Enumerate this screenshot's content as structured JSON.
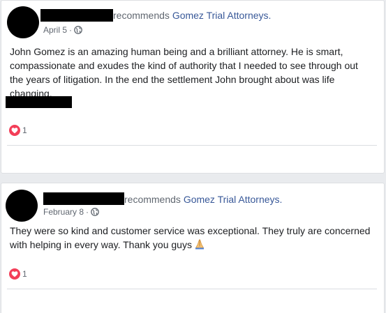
{
  "posts": [
    {
      "recommends_text": "recommends ",
      "page_name": "Gomez Trial Attorneys.",
      "date": "April 5",
      "separator": "·",
      "privacy_icon": "globe-icon",
      "body": "John Gomez is an amazing human being and a brilliant attorney. He is smart, compassionate and exudes the kind of authority that I needed to see through out the years of litigation. In the end the settlement John brought about was life changing.",
      "reaction_icon": "heart-icon",
      "reaction_count": "1"
    },
    {
      "recommends_text": "recommends ",
      "page_name": "Gomez Trial Attorneys.",
      "date": "February 8",
      "separator": "·",
      "privacy_icon": "globe-icon",
      "body": "They were so kind and customer service was exceptional. They truly are concerned with helping in every way. Thank you guys",
      "emoji": "folded-hands-icon",
      "reaction_icon": "heart-icon",
      "reaction_count": "1"
    }
  ],
  "colors": {
    "link": "#385898",
    "secondary_text": "#606770",
    "primary_text": "#1c1e21",
    "love_red": "#f33e58",
    "redaction": "#000000"
  }
}
